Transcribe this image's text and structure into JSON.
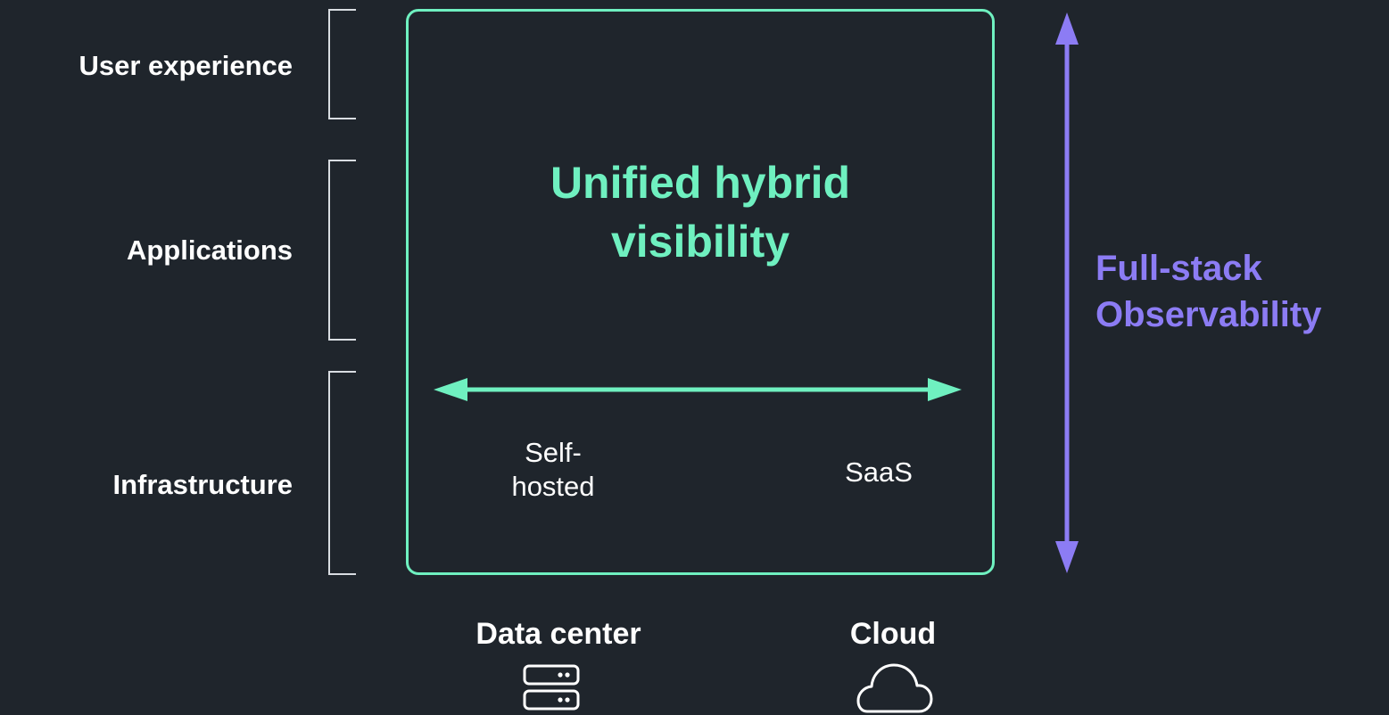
{
  "layers": {
    "user_experience": "User experience",
    "applications": "Applications",
    "infrastructure": "Infrastructure"
  },
  "box": {
    "title": "Unified hybrid\nvisibility",
    "self_hosted": "Self-\nhosted",
    "saas": "SaaS"
  },
  "side": {
    "title": "Full-stack\nObservability"
  },
  "locations": {
    "data_center": "Data center",
    "cloud": "Cloud"
  },
  "icons": {
    "data_center": "server-icon",
    "cloud": "cloud-icon"
  },
  "colors": {
    "background": "#1f252c",
    "accent_green": "#6ff0c0",
    "accent_purple": "#8c7cf4",
    "bracket": "#d9dde2"
  }
}
